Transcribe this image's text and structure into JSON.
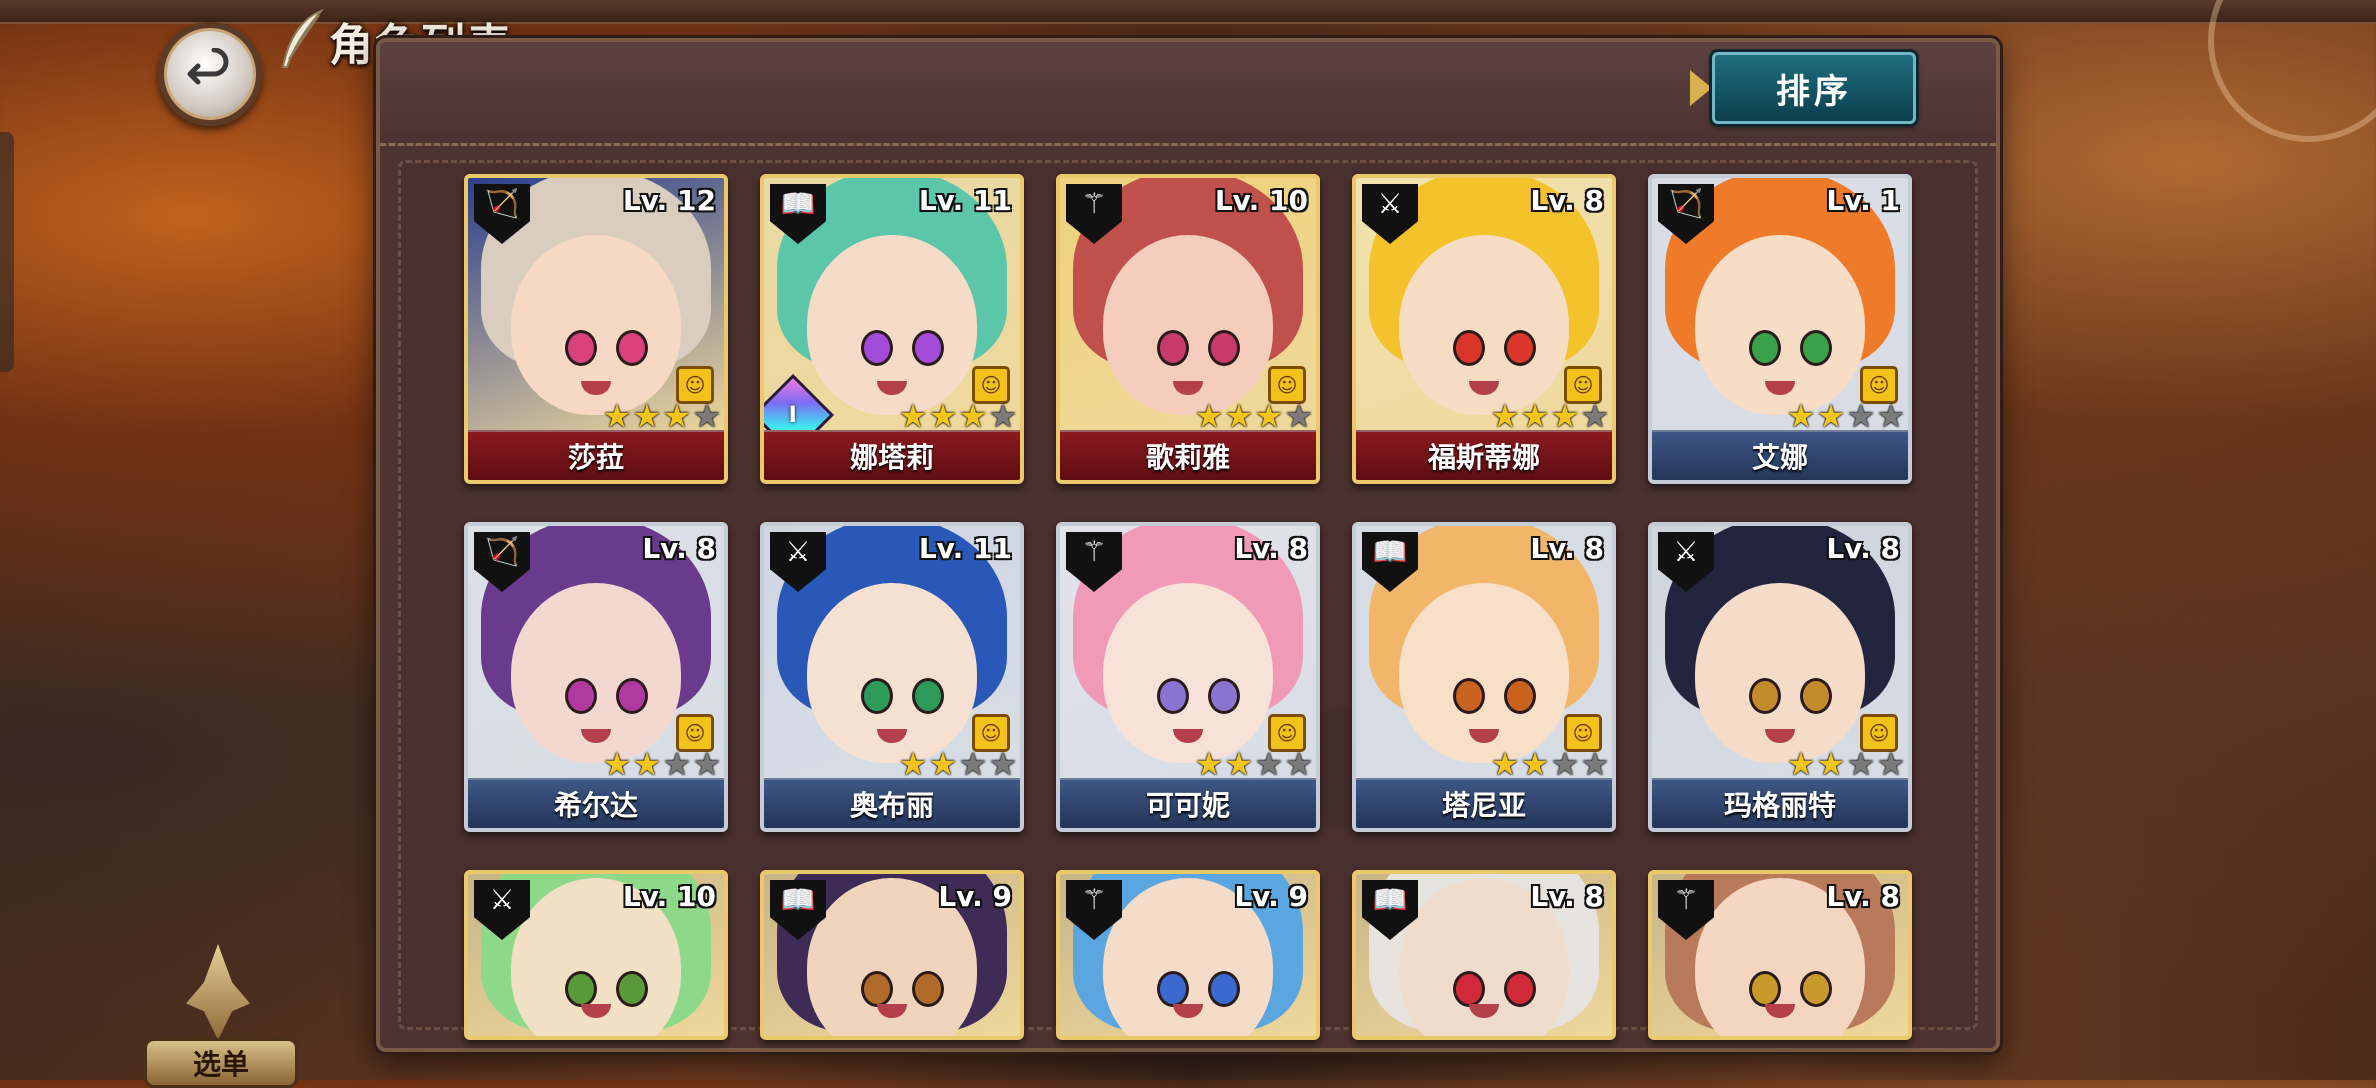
{
  "header": {
    "title": "角色列表",
    "back_label": "back"
  },
  "toolbar": {
    "sort_label": "排序"
  },
  "menu": {
    "label": "选单"
  },
  "characters": [
    {
      "name": "莎菈",
      "level": "Lv. 12",
      "class": "bow",
      "rarity": "gold",
      "stars": 3,
      "skin": "#f6d8c4",
      "hair": "#d8cdbf",
      "eye": "#d9417a",
      "bg": "#2c3f8c",
      "emote": true,
      "bonus": ""
    },
    {
      "name": "娜塔莉",
      "level": "Lv. 11",
      "class": "book",
      "rarity": "gold",
      "stars": 3,
      "skin": "#f6dcc8",
      "hair": "#5cc7a8",
      "eye": "#a24bd8",
      "bg": "#e9d9a4",
      "emote": true,
      "bonus": "I"
    },
    {
      "name": "歌莉雅",
      "level": "Lv. 10",
      "class": "staff",
      "rarity": "gold",
      "stars": 3,
      "skin": "#f4cdbd",
      "hair": "#c0504c",
      "eye": "#c73a6a",
      "bg": "#f0d27a",
      "emote": true,
      "bonus": ""
    },
    {
      "name": "福斯蒂娜",
      "level": "Lv. 8",
      "class": "sword",
      "rarity": "gold",
      "stars": 3,
      "skin": "#f7dcc4",
      "hair": "#f4c22a",
      "eye": "#d9352a",
      "bg": "#f1e2b0",
      "emote": true,
      "bonus": ""
    },
    {
      "name": "艾娜",
      "level": "Lv. 1",
      "class": "bow",
      "rarity": "silver",
      "stars": 2,
      "skin": "#f7dcc6",
      "hair": "#ef7a2a",
      "eye": "#3aa04a",
      "bg": "#d8dde6",
      "emote": true,
      "bonus": ""
    },
    {
      "name": "希尔达",
      "level": "Lv. 8",
      "class": "bow",
      "rarity": "silver",
      "stars": 2,
      "skin": "#f3d8d0",
      "hair": "#6a3a8c",
      "eye": "#b03aa0",
      "bg": "#dcdfe6",
      "emote": true,
      "bonus": ""
    },
    {
      "name": "奥布丽",
      "level": "Lv. 11",
      "class": "sword",
      "rarity": "silver",
      "stars": 2,
      "skin": "#f6e0d2",
      "hair": "#2a58b8",
      "eye": "#2c9a5a",
      "bg": "#cfd6e2",
      "emote": true,
      "bonus": ""
    },
    {
      "name": "可可妮",
      "level": "Lv. 8",
      "class": "staff",
      "rarity": "silver",
      "stars": 2,
      "skin": "#f8e2d8",
      "hair": "#f09ab8",
      "eye": "#8a74d0",
      "bg": "#e2e2ea",
      "emote": true,
      "bonus": ""
    },
    {
      "name": "塔尼亚",
      "level": "Lv. 8",
      "class": "book",
      "rarity": "silver",
      "stars": 2,
      "skin": "#f8e0c8",
      "hair": "#f2b66a",
      "eye": "#c8621e",
      "bg": "#d6dbe4",
      "emote": true,
      "bonus": ""
    },
    {
      "name": "玛格丽特",
      "level": "Lv. 8",
      "class": "sword",
      "rarity": "silver",
      "stars": 2,
      "skin": "#f4dcc8",
      "hair": "#23243e",
      "eye": "#c28a2a",
      "bg": "#cfd4dc",
      "emote": true,
      "bonus": ""
    },
    {
      "name": "",
      "level": "Lv. 10",
      "class": "sword",
      "rarity": "gold",
      "stars": 0,
      "skin": "#f2e0c4",
      "hair": "#8ed88a",
      "eye": "#5a9a3a",
      "bg": "#c9b487",
      "emote": false,
      "bonus": ""
    },
    {
      "name": "",
      "level": "Lv. 9",
      "class": "book",
      "rarity": "gold",
      "stars": 0,
      "skin": "#f0d4bc",
      "hair": "#3e2c56",
      "eye": "#b06a2a",
      "bg": "#c9b487",
      "emote": false,
      "bonus": ""
    },
    {
      "name": "",
      "level": "Lv. 9",
      "class": "staff",
      "rarity": "gold",
      "stars": 0,
      "skin": "#f4dcc8",
      "hair": "#5aa6e0",
      "eye": "#3a6ad0",
      "bg": "#c9b487",
      "emote": false,
      "bonus": ""
    },
    {
      "name": "",
      "level": "Lv. 8",
      "class": "book",
      "rarity": "gold",
      "stars": 0,
      "skin": "#f0dccc",
      "hair": "#e6e2de",
      "eye": "#d02a3a",
      "bg": "#c9b487",
      "emote": false,
      "bonus": ""
    },
    {
      "name": "",
      "level": "Lv. 8",
      "class": "staff",
      "rarity": "gold",
      "stars": 0,
      "skin": "#f4d6c0",
      "hair": "#b87a5a",
      "eye": "#c89a2a",
      "bg": "#c9b487",
      "emote": false,
      "bonus": ""
    }
  ]
}
